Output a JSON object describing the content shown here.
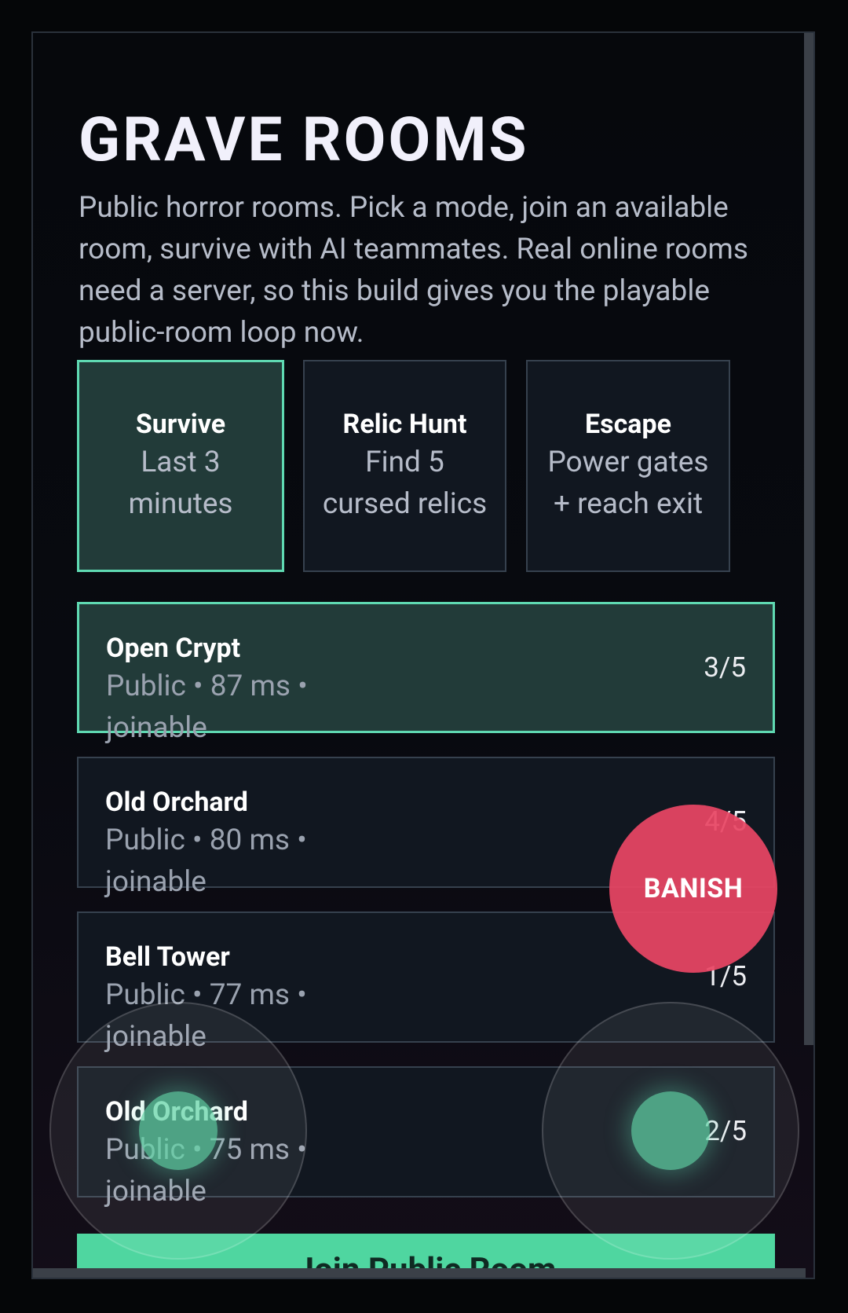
{
  "title": "GRAVE ROOMS",
  "intro": "Public horror rooms. Pick a mode, join an available room, survive with AI teammates. Real online rooms need a server, so this build gives you the playable public-room loop now.",
  "modes": [
    {
      "name": "Survive",
      "desc": "Last 3 minutes",
      "selected": true
    },
    {
      "name": "Relic Hunt",
      "desc": "Find 5 cursed relics",
      "selected": false
    },
    {
      "name": "Escape",
      "desc": "Power gates + reach exit",
      "selected": false
    }
  ],
  "rooms": [
    {
      "name": "Open Crypt",
      "meta": "Public • 87 ms • joinable",
      "count": "3/5",
      "selected": true
    },
    {
      "name": "Old Orchard",
      "meta": "Public • 80 ms • joinable",
      "count": "4/5",
      "selected": false
    },
    {
      "name": "Bell Tower",
      "meta": "Public • 77 ms • joinable",
      "count": "1/5",
      "selected": false
    },
    {
      "name": "Old Orchard",
      "meta": "Public • 75 ms • joinable",
      "count": "2/5",
      "selected": false
    }
  ],
  "join_button": "Join Public Room",
  "banish_button": "BANISH",
  "colors": {
    "accent": "#5fd9b2",
    "join": "#4fd6a0",
    "banish": "#e84664",
    "selected_bg": "#223b39"
  }
}
